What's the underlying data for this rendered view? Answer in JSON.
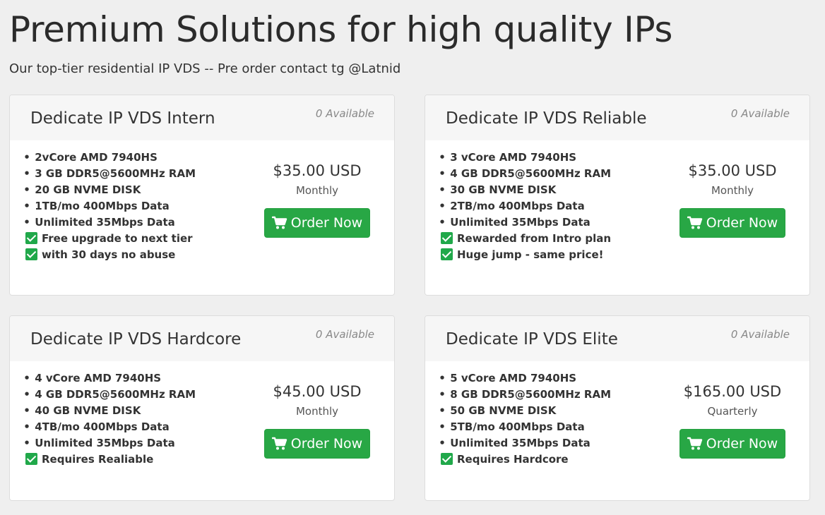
{
  "page": {
    "title": "Premium Solutions for high quality IPs",
    "subtitle": "Our top-tier residential IP VDS -- Pre order contact tg @Latnid"
  },
  "colors": {
    "background": "#efefef",
    "button": "#28a745",
    "check": "#20a84a"
  },
  "icons": {
    "order_button": "shopping-cart-icon",
    "feature_bonus": "check-mark-icon"
  },
  "products": [
    {
      "name": "Dedicate IP VDS Intern",
      "availability": "0 Available",
      "price": "$35.00 USD",
      "cycle": "Monthly",
      "order_label": "Order Now",
      "features": [
        {
          "type": "bullet",
          "marker": "•",
          "text": "2vCore AMD 7940HS"
        },
        {
          "type": "bullet",
          "marker": "•",
          "text": "3 GB DDR5@5600MHz RAM"
        },
        {
          "type": "bullet",
          "marker": "•",
          "text": "20 GB NVME DISK"
        },
        {
          "type": "bullet",
          "marker": "•",
          "text": "1TB/mo 400Mbps Data"
        },
        {
          "type": "bullet",
          "marker": "•",
          "text": "Unlimited 35Mbps Data"
        },
        {
          "type": "check",
          "marker": "",
          "text": "Free upgrade to next tier"
        },
        {
          "type": "check",
          "marker": "",
          "text": "with 30 days no abuse"
        }
      ]
    },
    {
      "name": "Dedicate IP VDS Reliable",
      "availability": "0 Available",
      "price": "$35.00 USD",
      "cycle": "Monthly",
      "order_label": "Order Now",
      "features": [
        {
          "type": "bullet",
          "marker": "•",
          "text": "3 vCore AMD 7940HS"
        },
        {
          "type": "bullet",
          "marker": "•",
          "text": "4 GB DDR5@5600MHz RAM"
        },
        {
          "type": "bullet",
          "marker": "•",
          "text": "30 GB NVME DISK"
        },
        {
          "type": "bullet",
          "marker": "•",
          "text": "2TB/mo 400Mbps Data"
        },
        {
          "type": "bullet",
          "marker": "•",
          "text": "Unlimited 35Mbps Data"
        },
        {
          "type": "check",
          "marker": "",
          "text": "Rewarded from Intro plan"
        },
        {
          "type": "check",
          "marker": "",
          "text": "Huge jump - same price!"
        }
      ]
    },
    {
      "name": "Dedicate IP VDS Hardcore",
      "availability": "0 Available",
      "price": "$45.00 USD",
      "cycle": "Monthly",
      "order_label": "Order Now",
      "features": [
        {
          "type": "bullet",
          "marker": "•",
          "text": "4 vCore AMD 7940HS"
        },
        {
          "type": "bullet",
          "marker": "•",
          "text": "4 GB DDR5@5600MHz RAM"
        },
        {
          "type": "bullet",
          "marker": "•",
          "text": "40 GB NVME DISK"
        },
        {
          "type": "bullet",
          "marker": "•",
          "text": "4TB/mo 400Mbps Data"
        },
        {
          "type": "bullet",
          "marker": "•",
          "text": "Unlimited 35Mbps Data"
        },
        {
          "type": "check",
          "marker": "",
          "text": "Requires Realiable"
        }
      ]
    },
    {
      "name": "Dedicate IP VDS Elite",
      "availability": "0 Available",
      "price": "$165.00 USD",
      "cycle": "Quarterly",
      "order_label": "Order Now",
      "features": [
        {
          "type": "bullet",
          "marker": "•",
          "text": "5 vCore AMD 7940HS"
        },
        {
          "type": "bullet",
          "marker": "•",
          "text": "8 GB DDR5@5600MHz RAM"
        },
        {
          "type": "bullet",
          "marker": "•",
          "text": "50 GB NVME DISK"
        },
        {
          "type": "bullet",
          "marker": "•",
          "text": "5TB/mo 400Mbps Data"
        },
        {
          "type": "bullet",
          "marker": "•",
          "text": "Unlimited 35Mbps Data"
        },
        {
          "type": "check",
          "marker": "",
          "text": "Requires Hardcore"
        }
      ]
    }
  ]
}
